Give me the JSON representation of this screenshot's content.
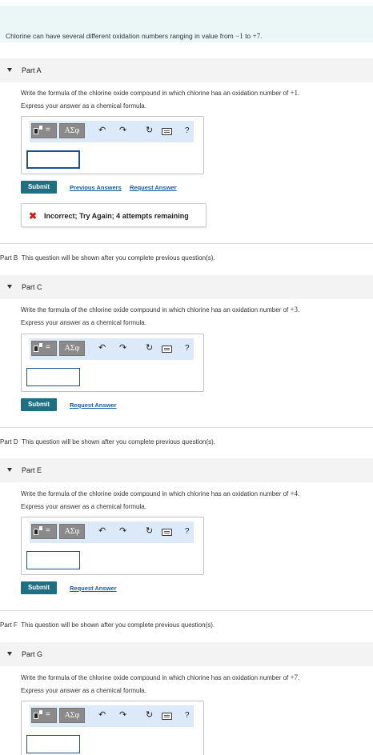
{
  "intro": {
    "text_before": "Chlorine can have several different oxidation numbers ranging in value from ",
    "min": "−1",
    "text_mid": " to ",
    "max": "+7",
    "text_after": "."
  },
  "question": {
    "prefix": "Write the formula of the chlorine oxide compound in which chlorine has an oxidation number of ",
    "instruction": "Express your answer as a chemical formula."
  },
  "toolbar": {
    "template_icon": "template-icon",
    "greek_label": "ΑΣφ",
    "undo_glyph": "↶",
    "redo_glyph": "↷",
    "reset_glyph": "↻",
    "keyboard_icon": "keyboard-icon",
    "help_label": "?"
  },
  "buttons": {
    "submit": "Submit",
    "previous_answers": "Previous Answers",
    "request_answer": "Request Answer"
  },
  "partA": {
    "title": "Part A",
    "oxidation": "+1",
    "feedback_icon": "✖",
    "feedback": "Incorrect; Try Again; 4 attempts remaining"
  },
  "partB": {
    "label": "Part B",
    "text": "This question will be shown after you complete previous question(s)."
  },
  "partC": {
    "title": "Part C",
    "oxidation": "+3"
  },
  "partD": {
    "label": "Part D",
    "text": "This question will be shown after you complete previous question(s)."
  },
  "partE": {
    "title": "Part E",
    "oxidation": "+4"
  },
  "partF": {
    "label": "Part F",
    "text": "This question will be shown after you complete previous question(s)."
  },
  "partG": {
    "title": "Part G",
    "oxidation": "+7"
  },
  "colors": {
    "submit": "#1e6f83",
    "link": "#1b5aa5",
    "intro_bg": "#eaf7f6",
    "toolbar_bg": "#dce9f8",
    "error": "#cc1f1f"
  }
}
